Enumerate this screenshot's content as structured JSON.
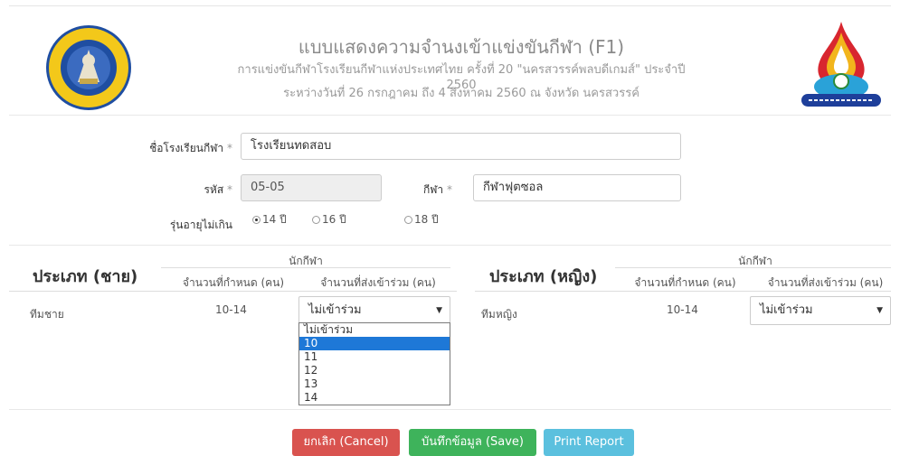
{
  "header": {
    "title": "แบบแสดงความจำนงเข้าแข่งขันกีฬา (F1)",
    "subtitle": "การแข่งขันกีฬาโรงเรียนกีฬาแห่งประเทศไทย ครั้งที่ 20 \"นครสวรรค์พลบดีเกมส์\" ประจำปี 2560",
    "dates": "ระหว่างวันที่ 26 กรกฎาคม ถึง 4 สิงหาคม 2560 ณ จังหวัด นครสวรรค์"
  },
  "form": {
    "school_label": "ชื่อโรงเรียนกีฬา",
    "school_value": "โรงเรียนทดสอบ",
    "code_label": "รหัส",
    "code_value": "05-05",
    "sport_label": "กีฬา",
    "sport_value": "กีฬาฟุตซอล",
    "required_mark": "*",
    "age_label": "รุ่นอายุไม่เกิน",
    "age_options": [
      "14 ปี",
      "16 ปี",
      "18 ปี"
    ],
    "age_selected": "14 ปี"
  },
  "male": {
    "section_title": "ประเภท (ชาย)",
    "group_header": "นักกีฬา",
    "col_quota": "จำนวนที่กำหนด (คน)",
    "col_send": "จำนวนที่ส่งเข้าร่วม (คน)",
    "team_label": "ทีมชาย",
    "quota_value": "10-14",
    "send_value": "ไม่เข้าร่วม"
  },
  "female": {
    "section_title": "ประเภท (หญิง)",
    "group_header": "นักกีฬา",
    "col_quota": "จำนวนที่กำหนด (คน)",
    "col_send": "จำนวนที่ส่งเข้าร่วม (คน)",
    "team_label": "ทีมหญิง",
    "quota_value": "10-14",
    "send_value": "ไม่เข้าร่วม"
  },
  "dropdown": {
    "options": [
      "ไม่เข้าร่วม",
      "10",
      "11",
      "12",
      "13",
      "14"
    ],
    "highlighted": "10"
  },
  "buttons": {
    "cancel": "ยกเลิก (Cancel)",
    "save": "บันทึกข้อมูล (Save)",
    "print": "Print Report"
  },
  "colors": {
    "cancel": "#d9534f",
    "save": "#3eb35b",
    "print": "#5bc0de",
    "highlight": "#1e78d7"
  }
}
